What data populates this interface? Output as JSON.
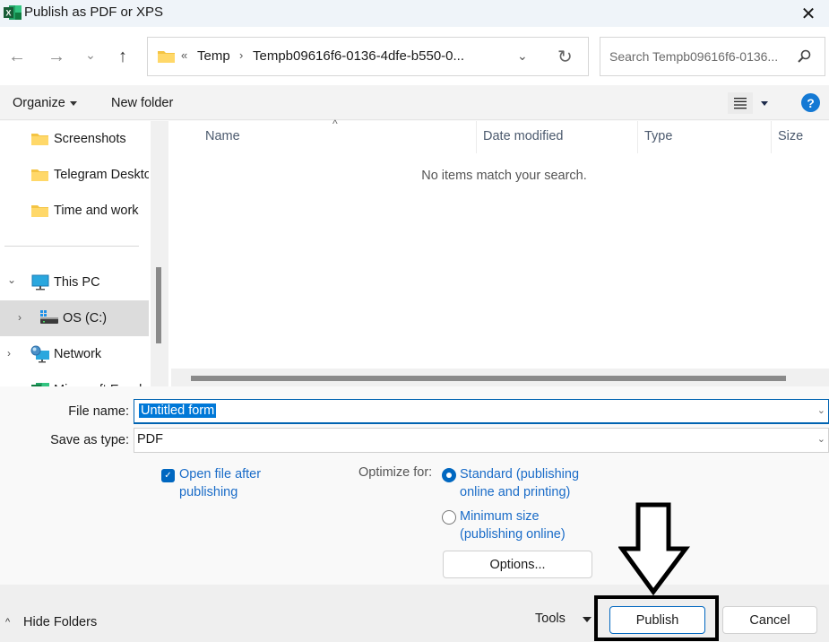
{
  "window": {
    "title": "Publish as PDF or XPS",
    "app_icon": "excel-icon",
    "close_glyph": "✕"
  },
  "nav": {
    "back_glyph": "←",
    "forward_glyph": "→",
    "recent_glyph": "⌄",
    "up_glyph": "↑",
    "address": {
      "overflow_glyph": "«",
      "segments": [
        "Temp",
        "Tempb09616f6-0136-4dfe-b550-0..."
      ],
      "separator_glyph": "›",
      "dropdown_glyph": "⌄",
      "refresh_glyph": "↻"
    },
    "search_placeholder": "Search Tempb09616f6-0136..."
  },
  "toolbar": {
    "organize_label": "Organize",
    "new_folder_label": "New folder",
    "help_glyph": "?"
  },
  "sidebar": {
    "items": [
      {
        "label": "Screenshots",
        "icon": "folder-icon"
      },
      {
        "label": "Telegram Desktop",
        "icon": "folder-icon"
      },
      {
        "label": "Time and work",
        "icon": "folder-icon"
      },
      {
        "label": "This PC",
        "icon": "computer-icon",
        "expanded": true
      },
      {
        "label": "OS (C:)",
        "icon": "drive-icon",
        "selected": true
      },
      {
        "label": "Network",
        "icon": "network-icon"
      },
      {
        "label": "Microsoft Excel",
        "icon": "excel-icon"
      }
    ],
    "chev_expanded": "⌄",
    "chev_collapsed": "›"
  },
  "filelist": {
    "columns": [
      "Name",
      "Date modified",
      "Type",
      "Size"
    ],
    "sort_glyph": "^",
    "empty_message": "No items match your search."
  },
  "form": {
    "file_name_label": "File name:",
    "file_name_value": "Untitled form",
    "save_type_label": "Save as type:",
    "save_type_value": "PDF",
    "dropdown_glyph": "⌄",
    "open_after": {
      "line1": "Open file after",
      "line2": "publishing",
      "checked": true
    },
    "optimize_label": "Optimize for:",
    "optimize_options": [
      {
        "line1": "Standard (publishing",
        "line2": "online and printing)",
        "selected": true
      },
      {
        "line1": "Minimum size",
        "line2": "(publishing online)",
        "selected": false
      }
    ],
    "options_button": "Options..."
  },
  "footer": {
    "hide_folders_label": "Hide Folders",
    "hide_chev": "^",
    "tools_label": "Tools",
    "publish_label": "Publish",
    "cancel_label": "Cancel"
  },
  "annotation": {
    "arrow": "down-arrow-pointing-to-publish",
    "box": "highlight-around-publish"
  }
}
